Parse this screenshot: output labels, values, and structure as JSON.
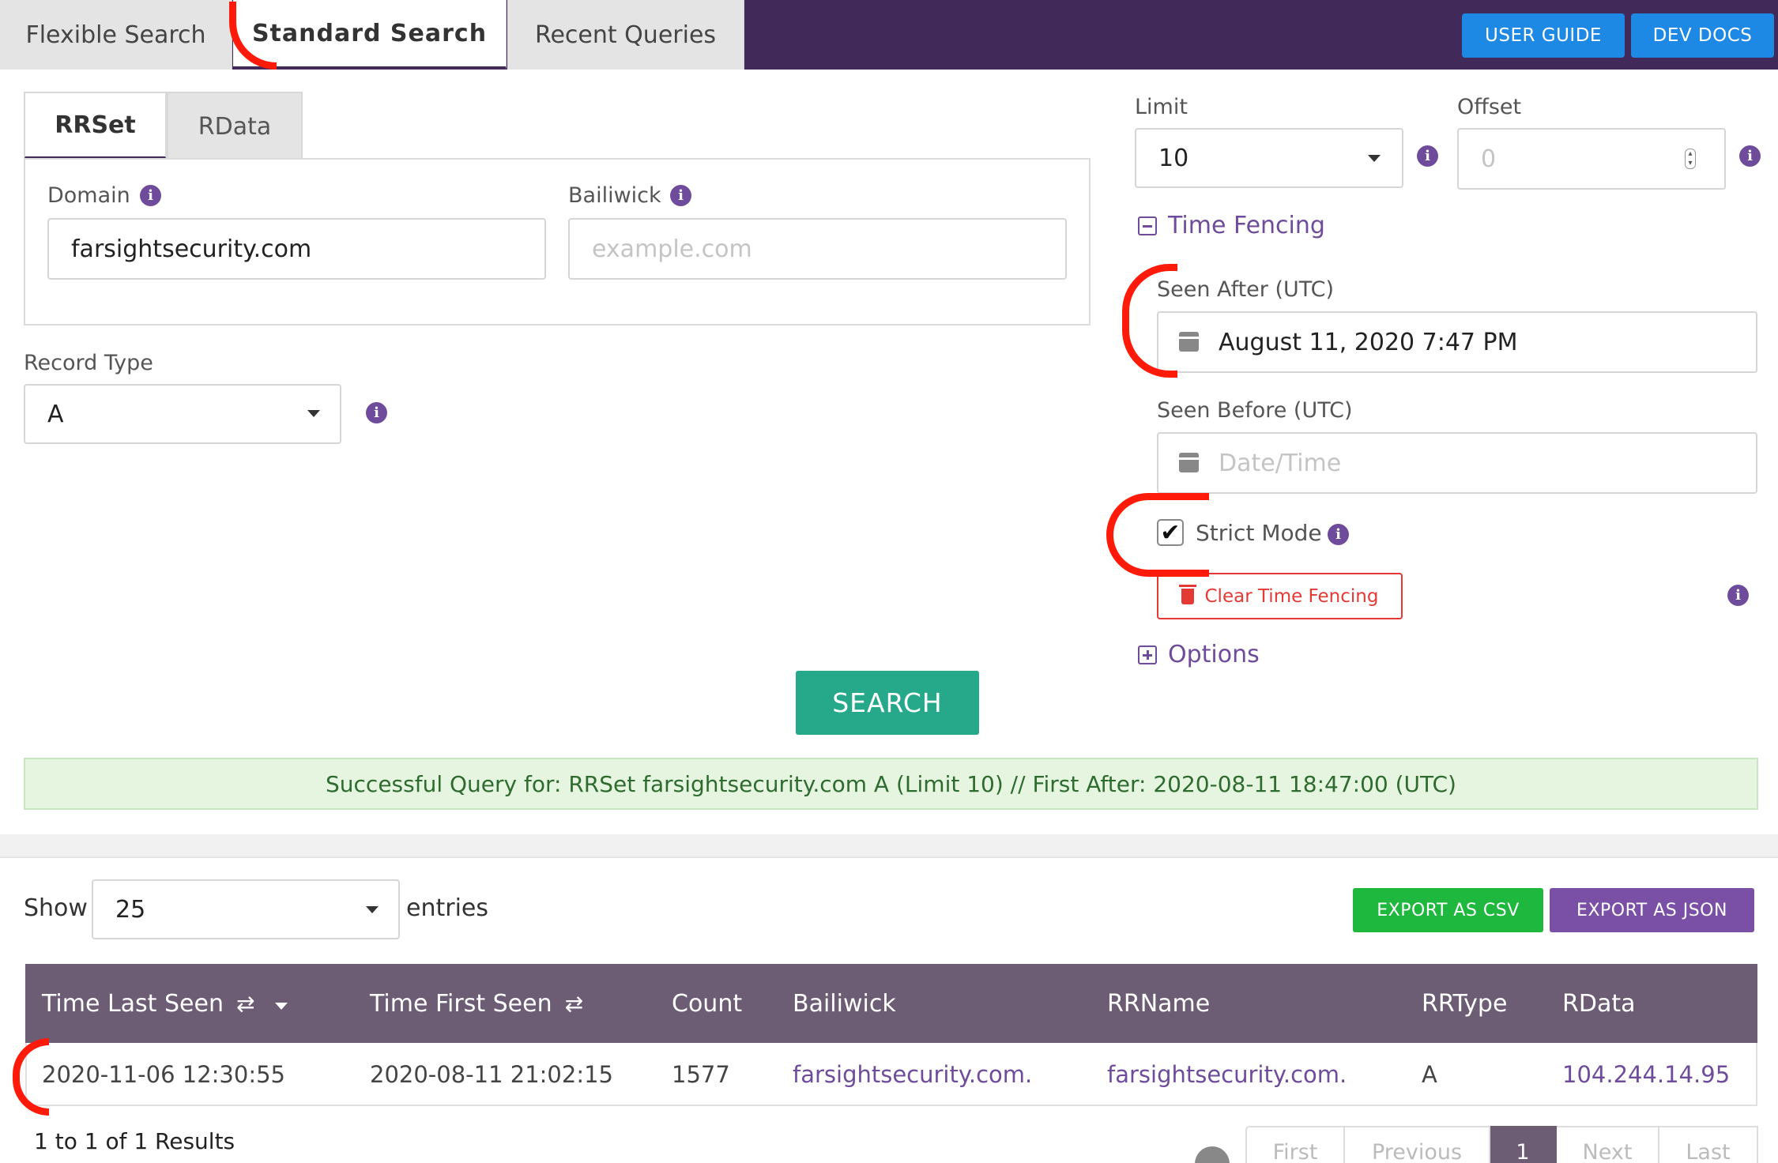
{
  "header": {
    "tabs": [
      {
        "label": "Flexible Search",
        "active": false
      },
      {
        "label": "Standard Search",
        "active": true
      },
      {
        "label": "Recent Queries",
        "active": false
      }
    ],
    "user_guide": "USER GUIDE",
    "dev_docs": "DEV DOCS"
  },
  "query": {
    "subtabs": [
      {
        "label": "RRSet",
        "active": true
      },
      {
        "label": "RData",
        "active": false
      }
    ],
    "domain": {
      "label": "Domain",
      "value": "farsightsecurity.com"
    },
    "bailiwick": {
      "label": "Bailiwick",
      "placeholder": "example.com"
    },
    "record_type": {
      "label": "Record Type",
      "value": "A"
    },
    "limit": {
      "label": "Limit",
      "value": "10"
    },
    "offset": {
      "label": "Offset",
      "placeholder": "0"
    },
    "time_fencing": {
      "label": "Time Fencing",
      "seen_after_label": "Seen After (UTC)",
      "seen_after_value": "August 11, 2020 7:47 PM",
      "seen_before_label": "Seen Before (UTC)",
      "seen_before_placeholder": "Date/Time",
      "strict_mode_label": "Strict Mode",
      "strict_mode_checked": true,
      "clear_label": "Clear Time Fencing"
    },
    "options_label": "Options",
    "search_label": "SEARCH",
    "success_message": "Successful Query for: RRSet farsightsecurity.com A (Limit 10) // First After: 2020-08-11 18:47:00 (UTC)"
  },
  "results": {
    "show_label": "Show",
    "entries_value": "25",
    "entries_label": "entries",
    "export_csv": "EXPORT AS CSV",
    "export_json": "EXPORT AS JSON",
    "columns": [
      "Time Last Seen",
      "Time First Seen",
      "Count",
      "Bailiwick",
      "RRName",
      "RRType",
      "RData"
    ],
    "rows": [
      [
        "2020-11-06 12:30:55",
        "2020-08-11 21:02:15",
        "1577",
        "farsightsecurity.com.",
        "farsightsecurity.com.",
        "A",
        "104.244.14.95"
      ]
    ],
    "summary": "1 to 1 of 1 Results",
    "pagination": [
      "First",
      "Previous",
      "1",
      "Next",
      "Last"
    ],
    "current_page": "1"
  },
  "colors": {
    "header_bg": "#41295a",
    "accent_purple": "#6f4c9b",
    "table_header_bg": "#6d5d74",
    "search_button": "#26a88a",
    "csv_button": "#1fb83f",
    "json_button": "#7a4fa6",
    "doc_buttons": "#1e88e5",
    "clear_button": "#e53935",
    "annotation_red": "#ff1a0a"
  }
}
